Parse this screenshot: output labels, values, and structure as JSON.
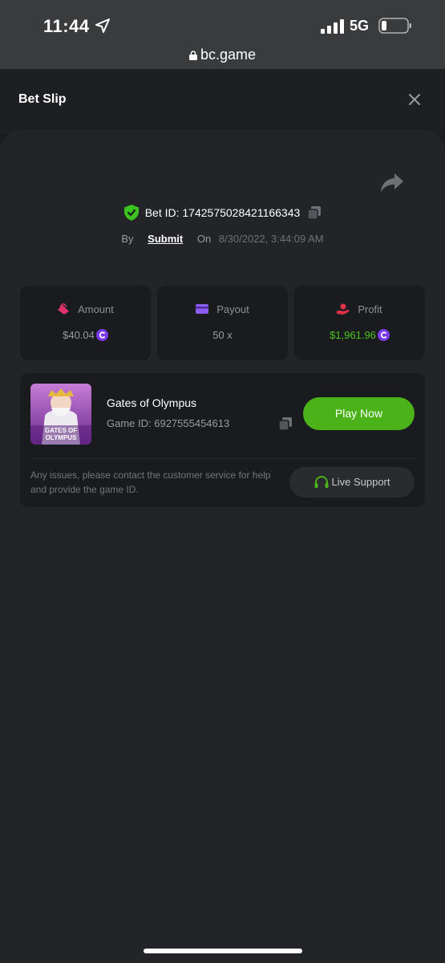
{
  "status_bar": {
    "time": "11:44",
    "network": "5G",
    "url": "bc.game"
  },
  "header": {
    "title": "Bet Slip"
  },
  "bet": {
    "id_label": "Bet ID: 1742575028421166343",
    "by_label": "By",
    "user": "Submit",
    "on_label": "On",
    "date": "8/30/2022, 3:44:09 AM"
  },
  "stats": {
    "amount": {
      "label": "Amount",
      "value": "$40.04"
    },
    "payout": {
      "label": "Payout",
      "value": "50 x"
    },
    "profit": {
      "label": "Profit",
      "value": "$1,961.96"
    }
  },
  "game": {
    "name": "Gates of Olympus",
    "id_label": "Game ID: 6927555454613",
    "thumb_text": "GATES OF OLYMPUS",
    "play_label": "Play Now",
    "help_text": "Any issues, please contact the customer service for help and provide the game ID.",
    "support_label": "Live Support"
  },
  "colors": {
    "accent_green": "#4bb319",
    "profit_green": "#4ac61b",
    "amount_icon": "#e0336b",
    "payout_icon": "#8b5cf6",
    "profit_icon": "#e0334a",
    "coin": "#7c3aed"
  },
  "icons": [
    "location-arrow-icon",
    "signal-icon",
    "battery-icon",
    "lock-icon",
    "close-icon",
    "share-icon",
    "shield-check-icon",
    "copy-icon",
    "amount-icon",
    "payout-icon",
    "profit-icon",
    "coin-icon",
    "headset-icon"
  ]
}
